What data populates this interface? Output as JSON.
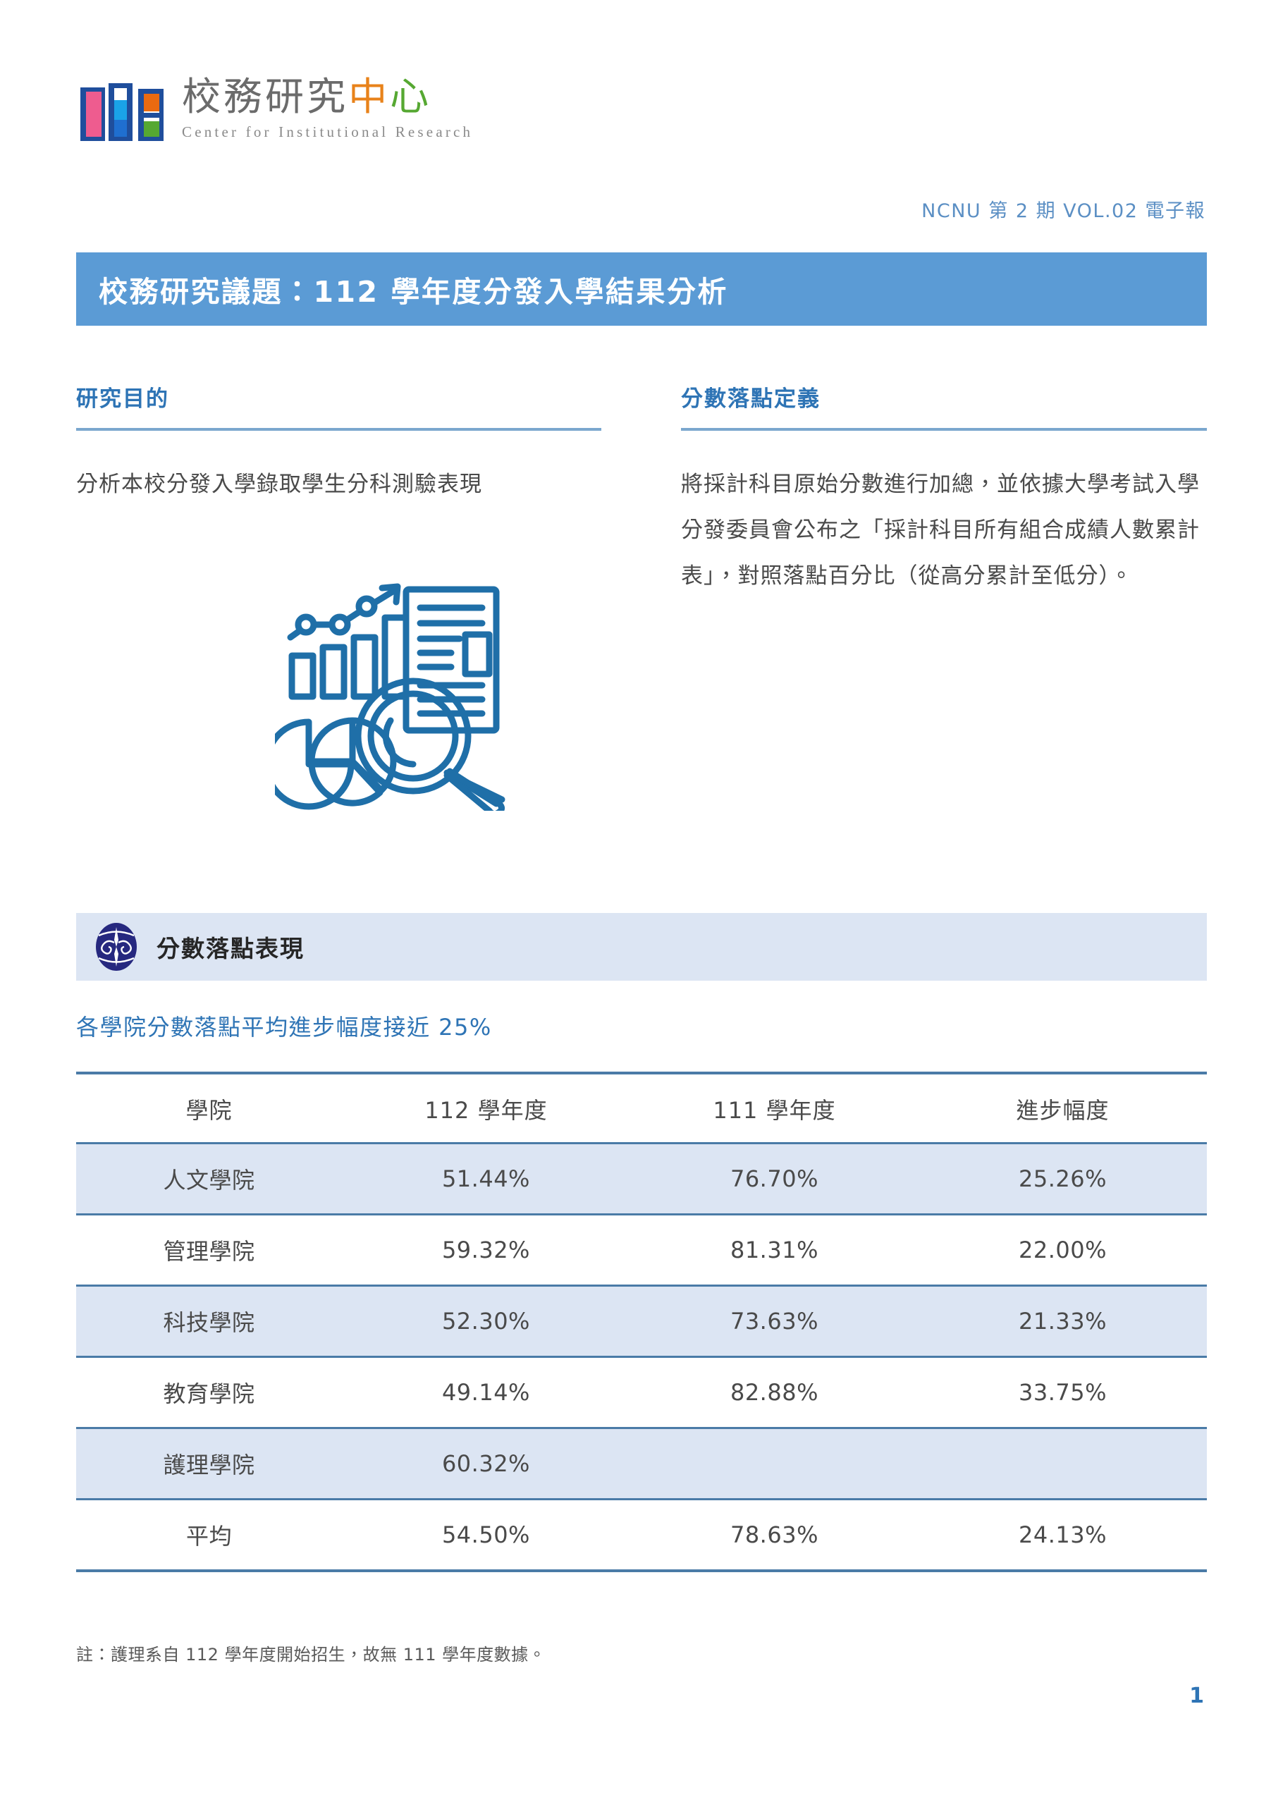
{
  "brand": {
    "logo_icon": "cir-books-logo",
    "name_cn": "校務研究中心",
    "name_cn_chars": [
      "校",
      "務",
      "研",
      "究",
      "中",
      "心"
    ],
    "name_en": "Center for Institutional Research"
  },
  "header": {
    "issue_line": "NCNU 第 2 期 VOL.02 電子報"
  },
  "title_bar": {
    "text": "校務研究議題：112 學年度分發入學結果分析",
    "background_color": "#5b9bd5",
    "text_color": "#ffffff"
  },
  "intro": {
    "left": {
      "heading": "研究目的",
      "body": "分析本校分發入學錄取學生分科測驗表現"
    },
    "right": {
      "heading": "分數落點定義",
      "body": "將採計科目原始分數進行加總，並依據大學考試入學分發委員會公布之「採計科目所有組合成績人數累計表」，對照落點百分比（從高分累計至低分）。"
    },
    "illustration_icon": "data-analysis-magnifier-icon"
  },
  "section": {
    "logo_icon": "ncnu-oval-logo",
    "banner_title": "分數落點表現",
    "banner_color": "#dce5f3",
    "subtitle": "各學院分數落點平均進步幅度接近 25%"
  },
  "chart_data": {
    "type": "table",
    "title": "各學院分數落點平均進步幅度接近 25%",
    "columns": [
      "學院",
      "112 學年度",
      "111 學年度",
      "進步幅度"
    ],
    "rows": [
      {
        "college": "人文學院",
        "y112": "51.44%",
        "y111": "76.70%",
        "delta": "25.26%"
      },
      {
        "college": "管理學院",
        "y112": "59.32%",
        "y111": "81.31%",
        "delta": "22.00%"
      },
      {
        "college": "科技學院",
        "y112": "52.30%",
        "y111": "73.63%",
        "delta": "21.33%"
      },
      {
        "college": "教育學院",
        "y112": "49.14%",
        "y111": "82.88%",
        "delta": "33.75%"
      },
      {
        "college": "護理學院",
        "y112": "60.32%",
        "y111": "",
        "delta": ""
      },
      {
        "college": "平均",
        "y112": "54.50%",
        "y111": "78.63%",
        "delta": "24.13%"
      }
    ],
    "series": [
      {
        "name": "112 學年度",
        "values": [
          51.44,
          59.32,
          52.3,
          49.14,
          60.32,
          54.5
        ]
      },
      {
        "name": "111 學年度",
        "values": [
          76.7,
          81.31,
          73.63,
          82.88,
          null,
          78.63
        ]
      },
      {
        "name": "進步幅度",
        "values": [
          25.26,
          22.0,
          21.33,
          33.75,
          null,
          24.13
        ]
      }
    ],
    "categories": [
      "人文學院",
      "管理學院",
      "科技學院",
      "教育學院",
      "護理學院",
      "平均"
    ],
    "unit": "%"
  },
  "footnote": "註：護理系自 112 學年度開始招生，故無 111 學年度數據。",
  "page_number": "1",
  "colors": {
    "accent_blue": "#2e74b5",
    "banner_blue": "#5b9bd5",
    "light_blue": "#dce5f3",
    "rule_blue": "#4a7ba7",
    "issue_blue": "#5b8fc4",
    "ncnu_navy": "#26287f"
  }
}
